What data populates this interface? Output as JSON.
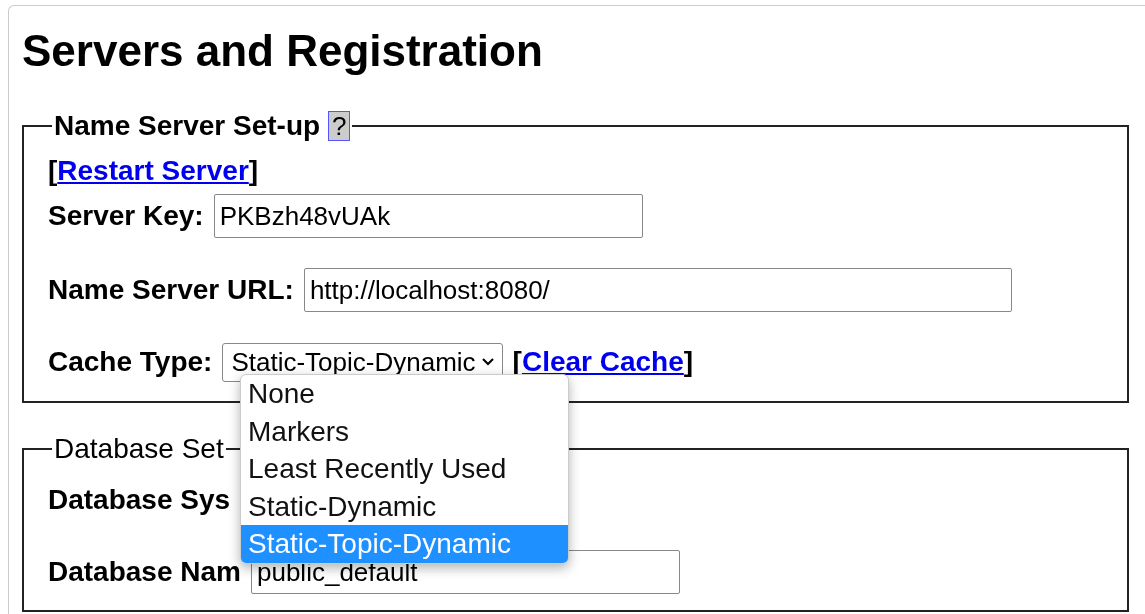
{
  "page": {
    "title": "Servers and Registration"
  },
  "name_server": {
    "legend": "Name Server Set-up",
    "help": "?",
    "restart": {
      "open": "[",
      "link": "Restart Server",
      "close": "]"
    },
    "fields": [
      {
        "kind": "text",
        "label": "Server Key:",
        "value": "PKBzh48vUAk"
      },
      {
        "kind": "text",
        "label": "Name Server URL:",
        "value": "http://localhost:8080/"
      },
      {
        "kind": "select",
        "label": "Cache Type:",
        "value": "Static-Topic-Dynamic",
        "open": "[",
        "link": "Clear Cache",
        "close": "]"
      }
    ]
  },
  "cache_dropdown": {
    "options": [
      {
        "label": "None",
        "selected": false
      },
      {
        "label": "Markers",
        "selected": false
      },
      {
        "label": "Least Recently Used",
        "selected": false
      },
      {
        "label": "Static-Dynamic",
        "selected": false
      },
      {
        "label": "Static-Topic-Dynamic",
        "selected": true
      }
    ]
  },
  "database": {
    "legend": "Database Set",
    "fields": [
      {
        "kind": "label",
        "label": "Database Sys"
      },
      {
        "kind": "text",
        "label": "Database Nam",
        "value": "public_default"
      }
    ]
  }
}
